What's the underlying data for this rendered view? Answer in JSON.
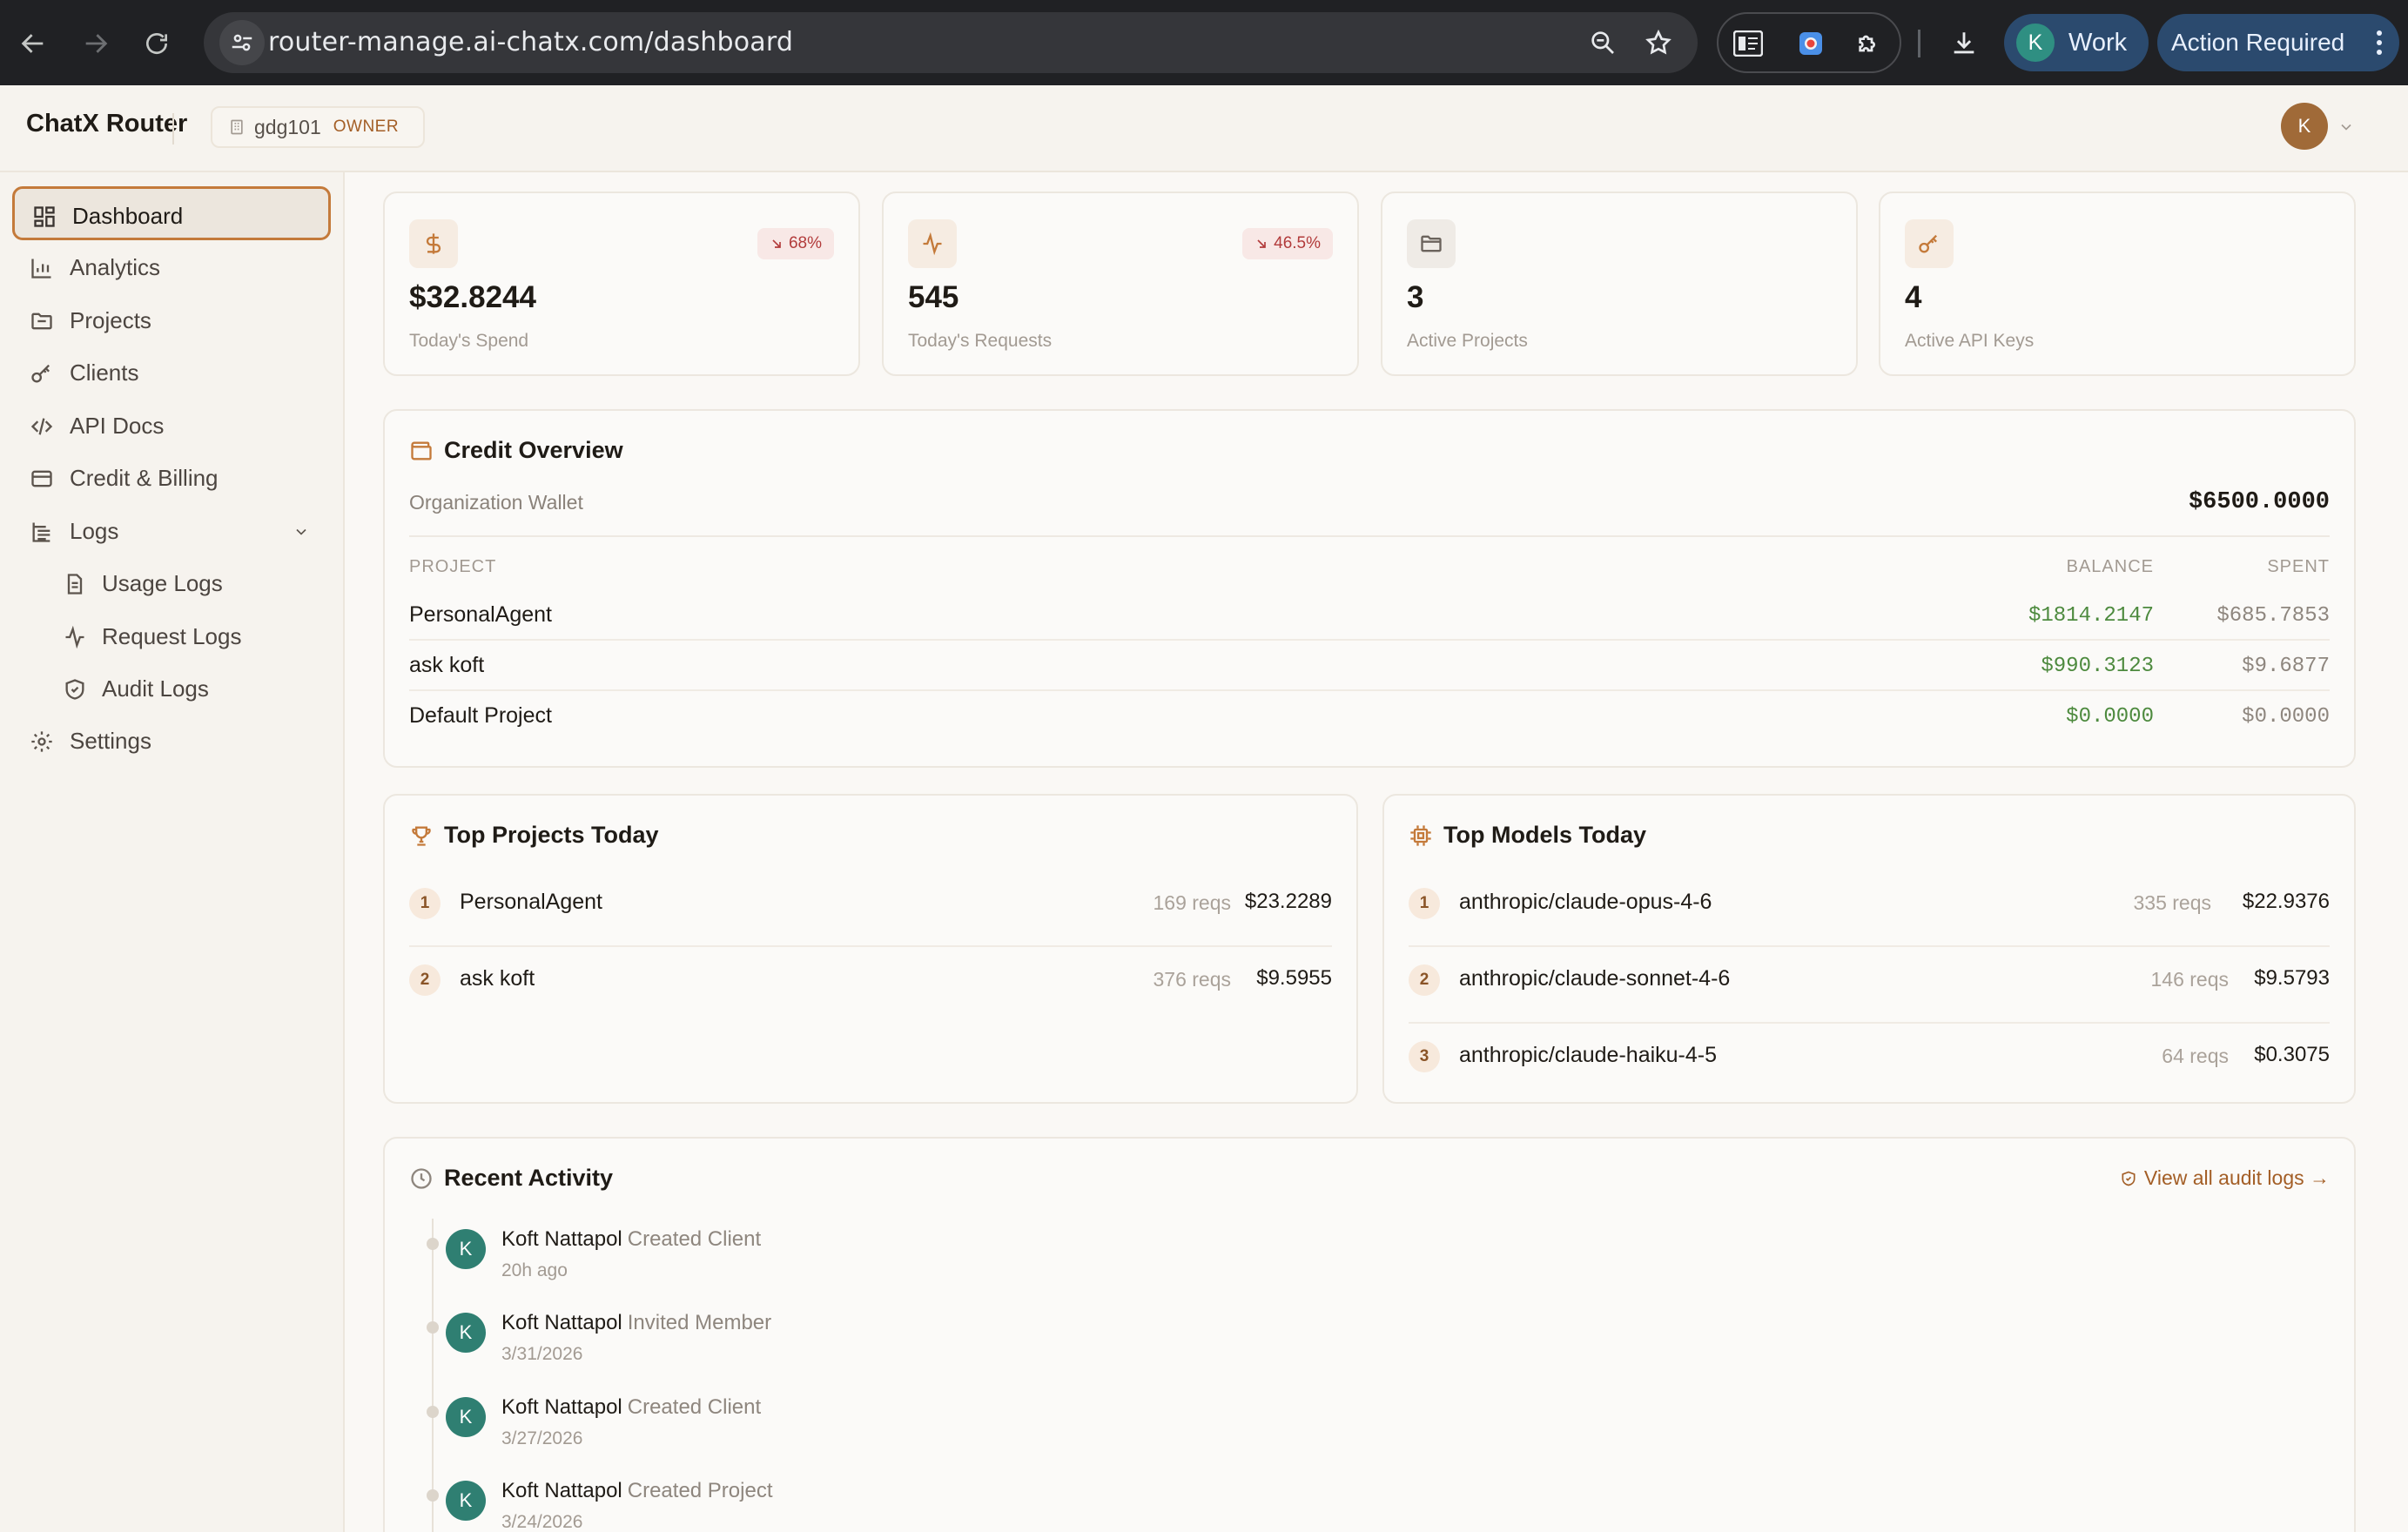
{
  "browser": {
    "url": "router-manage.ai-chatx.com/dashboard",
    "profile_initial": "K",
    "profile_label": "Work",
    "action_label": "Action Required"
  },
  "header": {
    "brand": "ChatX Router",
    "org_name": "gdg101",
    "org_role": "OWNER",
    "user_initial": "K"
  },
  "sidebar": {
    "items": [
      {
        "label": "Dashboard",
        "icon": "dashboard-icon"
      },
      {
        "label": "Analytics",
        "icon": "chart-icon"
      },
      {
        "label": "Projects",
        "icon": "folder-icon"
      },
      {
        "label": "Clients",
        "icon": "key-icon"
      },
      {
        "label": "API Docs",
        "icon": "code-icon"
      },
      {
        "label": "Credit & Billing",
        "icon": "credit-card-icon"
      },
      {
        "label": "Logs",
        "icon": "logs-icon"
      }
    ],
    "logs_sub": [
      {
        "label": "Usage Logs",
        "icon": "file-icon"
      },
      {
        "label": "Request Logs",
        "icon": "activity-icon"
      },
      {
        "label": "Audit Logs",
        "icon": "shield-icon"
      }
    ],
    "settings": {
      "label": "Settings",
      "icon": "gear-icon"
    }
  },
  "stats": [
    {
      "value": "$32.8244",
      "label": "Today's Spend",
      "change": "68%",
      "icon": "dollar-icon"
    },
    {
      "value": "545",
      "label": "Today's Requests",
      "change": "46.5%",
      "icon": "activity-icon"
    },
    {
      "value": "3",
      "label": "Active Projects",
      "icon": "folder-icon"
    },
    {
      "value": "4",
      "label": "Active API Keys",
      "icon": "key-icon"
    }
  ],
  "credit": {
    "title": "Credit Overview",
    "wallet_label": "Organization Wallet",
    "wallet_value": "$6500.0000",
    "col_project": "PROJECT",
    "col_balance": "BALANCE",
    "col_spent": "SPENT",
    "rows": [
      {
        "project": "PersonalAgent",
        "balance": "$1814.2147",
        "spent": "$685.7853"
      },
      {
        "project": "ask koft",
        "balance": "$990.3123",
        "spent": "$9.6877"
      },
      {
        "project": "Default Project",
        "balance": "$0.0000",
        "spent": "$0.0000"
      }
    ]
  },
  "top_projects": {
    "title": "Top Projects Today",
    "rows": [
      {
        "rank": "1",
        "name": "PersonalAgent",
        "reqs": "169 reqs",
        "cost": "$23.2289"
      },
      {
        "rank": "2",
        "name": "ask koft",
        "reqs": "376 reqs",
        "cost": "$9.5955"
      }
    ]
  },
  "top_models": {
    "title": "Top Models Today",
    "rows": [
      {
        "rank": "1",
        "name": "anthropic/claude-opus-4-6",
        "reqs": "335 reqs",
        "cost": "$22.9376"
      },
      {
        "rank": "2",
        "name": "anthropic/claude-sonnet-4-6",
        "reqs": "146 reqs",
        "cost": "$9.5793"
      },
      {
        "rank": "3",
        "name": "anthropic/claude-haiku-4-5",
        "reqs": "64 reqs",
        "cost": "$0.3075"
      }
    ]
  },
  "activity": {
    "title": "Recent Activity",
    "view_all": "View all audit logs →",
    "items": [
      {
        "initial": "K",
        "who": "Koft Nattapol",
        "what": "Created Client",
        "when": "20h ago"
      },
      {
        "initial": "K",
        "who": "Koft Nattapol",
        "what": "Invited Member",
        "when": "3/31/2026"
      },
      {
        "initial": "K",
        "who": "Koft Nattapol",
        "what": "Created Client",
        "when": "3/27/2026"
      },
      {
        "initial": "K",
        "who": "Koft Nattapol",
        "what": "Created Project",
        "when": "3/24/2026"
      }
    ]
  },
  "colors": {
    "accent": "#c47a3a",
    "positive": "#4d8a3e",
    "negative": "#b23b3b",
    "chrome_bg": "#202124"
  }
}
